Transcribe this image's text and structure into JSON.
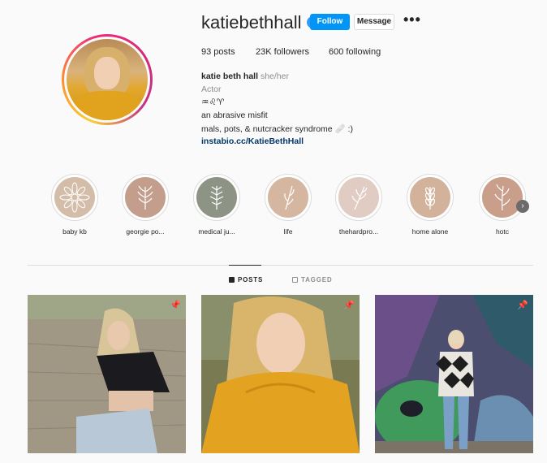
{
  "profile": {
    "username": "katiebethhall",
    "verified_mark": "✔",
    "follow_label": "Follow",
    "message_label": "Message",
    "more_label": "•••",
    "stats": {
      "posts": "93 posts",
      "followers": "23K followers",
      "following": "600 following"
    },
    "bio": {
      "name": "katie beth hall",
      "pronouns": "she/her",
      "category": "Actor",
      "line1": "♒♌♈",
      "line2": "an abrasive misfit",
      "line3": "mals, pots, & nutcracker syndrome 🩹 :)",
      "link": "instabio.cc/KatieBethHall"
    }
  },
  "highlights": [
    {
      "label": "baby kb",
      "color": "#d3bca8",
      "icon": "flower-icon"
    },
    {
      "label": "georgie po...",
      "color": "#c49e8c",
      "icon": "plant-icon"
    },
    {
      "label": "medical ju...",
      "color": "#8e9485",
      "icon": "plant-icon"
    },
    {
      "label": "life",
      "color": "#d5b7a1",
      "icon": "leaf-icon"
    },
    {
      "label": "thehardpro...",
      "color": "#e0ccc3",
      "icon": "plant-icon"
    },
    {
      "label": "home alone",
      "color": "#d2b29b",
      "icon": "wheat-icon"
    },
    {
      "label": "hotc",
      "color": "#c99e8b",
      "icon": "plant-icon"
    }
  ],
  "tabs": {
    "posts": "POSTS",
    "tagged": "TAGGED"
  },
  "posts": [
    {
      "name": "post-wall-crop-top",
      "pin": "📌"
    },
    {
      "name": "post-yellow-sweater",
      "pin": "📌"
    },
    {
      "name": "post-graffiti-wall",
      "pin": "📌"
    }
  ]
}
